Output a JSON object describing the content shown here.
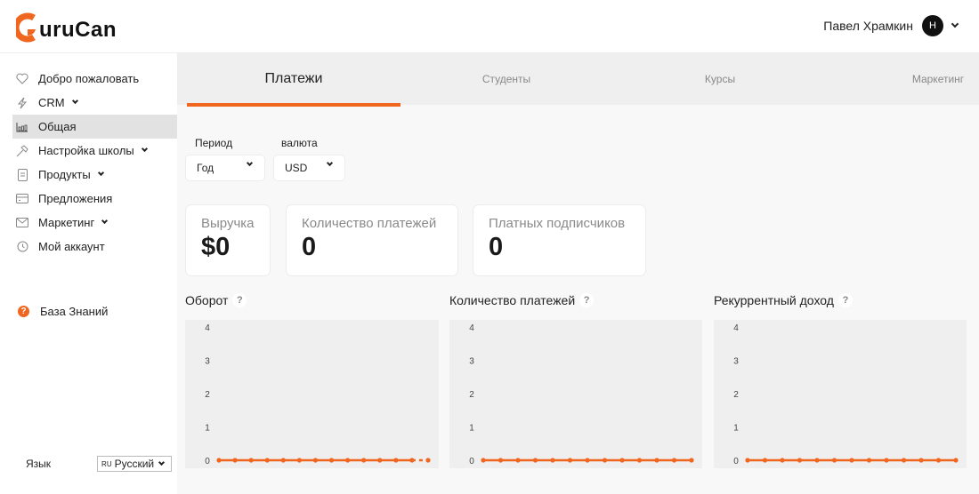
{
  "app": {
    "logo_text": "uruCan",
    "logo_letter": "G"
  },
  "header": {
    "user_name": "Павел Храмкин",
    "avatar_initial": "Н"
  },
  "sidebar": {
    "items": [
      {
        "label": "Добро пожаловать",
        "icon": "heart-icon",
        "has_submenu": false,
        "active": false
      },
      {
        "label": "CRM",
        "icon": "lightning-icon",
        "has_submenu": true,
        "active": false
      },
      {
        "label": "Общая",
        "icon": "bar-chart-icon",
        "has_submenu": false,
        "active": true
      },
      {
        "label": "Настройка школы",
        "icon": "hammer-icon",
        "has_submenu": true,
        "active": false
      },
      {
        "label": "Продукты",
        "icon": "document-icon",
        "has_submenu": true,
        "active": false
      },
      {
        "label": "Предложения",
        "icon": "credit-card-icon",
        "has_submenu": false,
        "active": false
      },
      {
        "label": "Маркетинг",
        "icon": "mail-icon",
        "has_submenu": true,
        "active": false
      },
      {
        "label": "Мой аккаунт",
        "icon": "account-icon",
        "has_submenu": false,
        "active": false
      }
    ],
    "knowledge_base": "База Знаний",
    "language_label": "Язык",
    "language_code": "RU",
    "language_value": "Русский"
  },
  "tabs": [
    {
      "label": "Платежи",
      "active": true
    },
    {
      "label": "Студенты",
      "active": false
    },
    {
      "label": "Курсы",
      "active": false
    },
    {
      "label": "Маркетинг",
      "active": false
    }
  ],
  "filters": {
    "period_label": "Период",
    "period_value": "Год",
    "currency_label": "валюта",
    "currency_value": "USD"
  },
  "stats": [
    {
      "label": "Выручка",
      "value": "$0"
    },
    {
      "label": "Количество платежей",
      "value": "0"
    },
    {
      "label": "Платных подписчиков",
      "value": "0"
    }
  ],
  "colors": {
    "accent": "#f0661f",
    "chart_bg": "#efefef"
  },
  "chart_data": [
    {
      "type": "line",
      "title": "Оборот",
      "help": "?",
      "ylim": [
        0,
        4
      ],
      "yticks": [
        "0",
        "1",
        "2",
        "3",
        "4"
      ],
      "series": [
        {
          "name": "Оборот",
          "values": [
            0,
            0,
            0,
            0,
            0,
            0,
            0,
            0,
            0,
            0,
            0,
            0,
            0,
            0
          ],
          "dashed_last_segment": true
        }
      ]
    },
    {
      "type": "line",
      "title": "Количество платежей",
      "help": "?",
      "ylim": [
        0,
        4
      ],
      "yticks": [
        "0",
        "1",
        "2",
        "3",
        "4"
      ],
      "series": [
        {
          "name": "Количество платежей",
          "values": [
            0,
            0,
            0,
            0,
            0,
            0,
            0,
            0,
            0,
            0,
            0,
            0,
            0
          ],
          "dashed_last_segment": false
        }
      ]
    },
    {
      "type": "line",
      "title": "Рекуррентный доход",
      "help": "?",
      "ylim": [
        0,
        4
      ],
      "yticks": [
        "0",
        "1",
        "2",
        "3",
        "4"
      ],
      "series": [
        {
          "name": "Рекуррентный доход",
          "values": [
            0,
            0,
            0,
            0,
            0,
            0,
            0,
            0,
            0,
            0,
            0,
            0,
            0
          ],
          "dashed_last_segment": false
        }
      ]
    }
  ]
}
